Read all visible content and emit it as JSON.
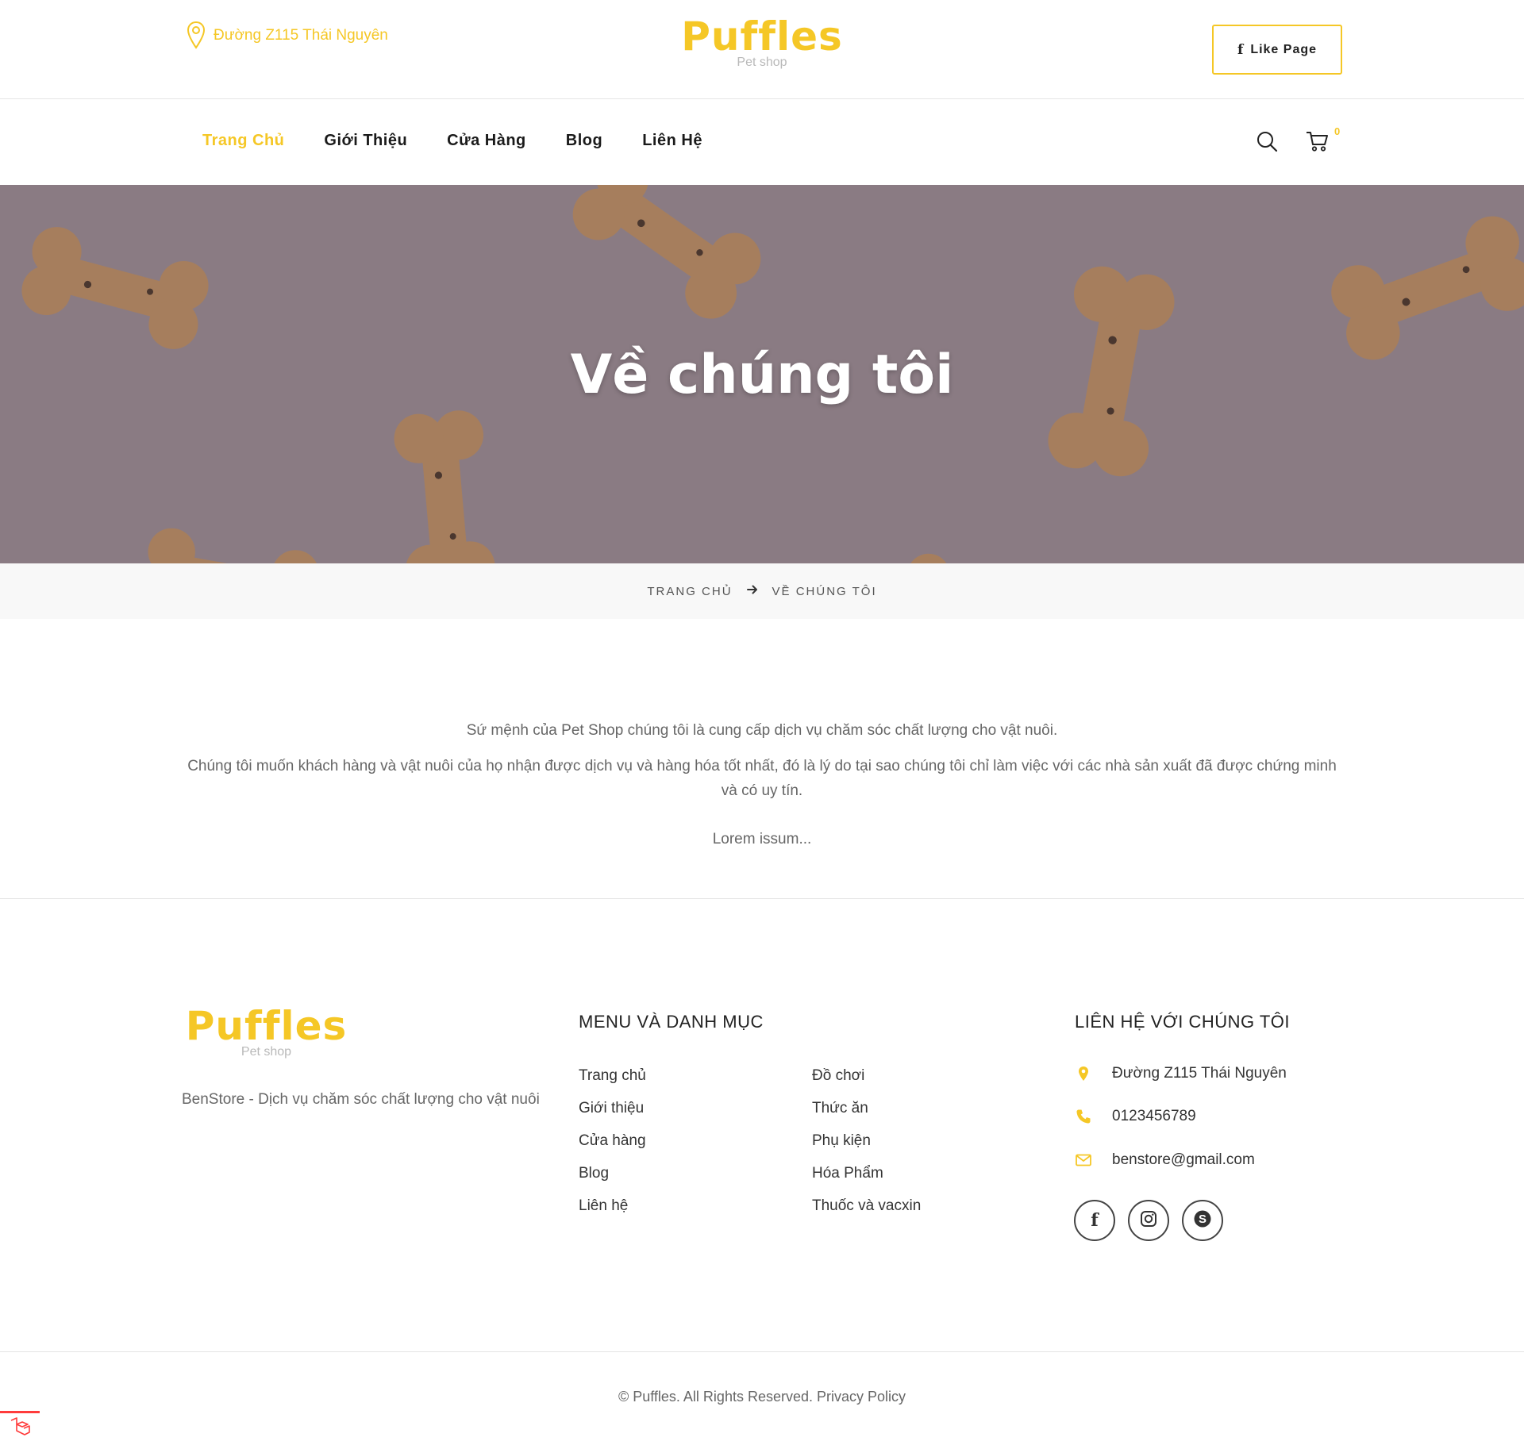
{
  "header": {
    "address": "Đường Z115 Thái Nguyên",
    "logo_text": "Puffles",
    "logo_tagline": "Pet shop",
    "like_button": "Like Page",
    "like_icon": "facebook-icon"
  },
  "nav": {
    "items": [
      {
        "label": "Trang Chủ",
        "active": true
      },
      {
        "label": "Giới Thiệu",
        "active": false
      },
      {
        "label": "Cửa Hàng",
        "active": false
      },
      {
        "label": "Blog",
        "active": false
      },
      {
        "label": "Liên Hệ",
        "active": false
      }
    ],
    "search_icon": "search-icon",
    "cart_icon": "cart-icon",
    "cart_count": "0"
  },
  "hero": {
    "title": "Về chúng tôi"
  },
  "breadcrumb": {
    "home": "TRANG CHỦ",
    "current": "VỀ CHÚNG TÔI"
  },
  "content": {
    "paragraph1": "Sứ mệnh của Pet Shop chúng tôi là cung cấp dịch vụ chăm sóc chất lượng cho vật nuôi.",
    "paragraph2": "Chúng tôi muốn khách hàng và vật nuôi của họ nhận được dịch vụ và hàng hóa tốt nhất, đó là lý do tại sao chúng tôi chỉ làm việc với các nhà sản xuất đã được chứng minh và có uy tín.",
    "paragraph3": "Lorem issum..."
  },
  "footer": {
    "logo_text": "Puffles",
    "logo_tagline": "Pet shop",
    "description": "BenStore - Dịch vụ chăm sóc chất lượng cho vật nuôi",
    "menu_heading": "MENU VÀ DANH MỤC",
    "menu_col1": [
      "Trang chủ",
      "Giới thiệu",
      "Cửa hàng",
      "Blog",
      "Liên hệ"
    ],
    "menu_col2": [
      "Đồ chơi",
      "Thức ăn",
      "Phụ kiện",
      "Hóa Phẩm",
      "Thuốc và vacxin"
    ],
    "contact_heading": "LIÊN HỆ VỚI CHÚNG TÔI",
    "contact_address": "Đường Z115 Thái Nguyên",
    "contact_phone": "0123456789",
    "contact_email": "benstore@gmail.com",
    "social": [
      "facebook-icon",
      "instagram-icon",
      "skype-icon"
    ],
    "copyright": "©  Puffles. All Rights Reserved. Privacy Policy"
  },
  "colors": {
    "accent": "#f5c726",
    "text_dark": "#222222",
    "text_muted": "#666666",
    "breadcrumb_bg": "#f8f8f8"
  }
}
